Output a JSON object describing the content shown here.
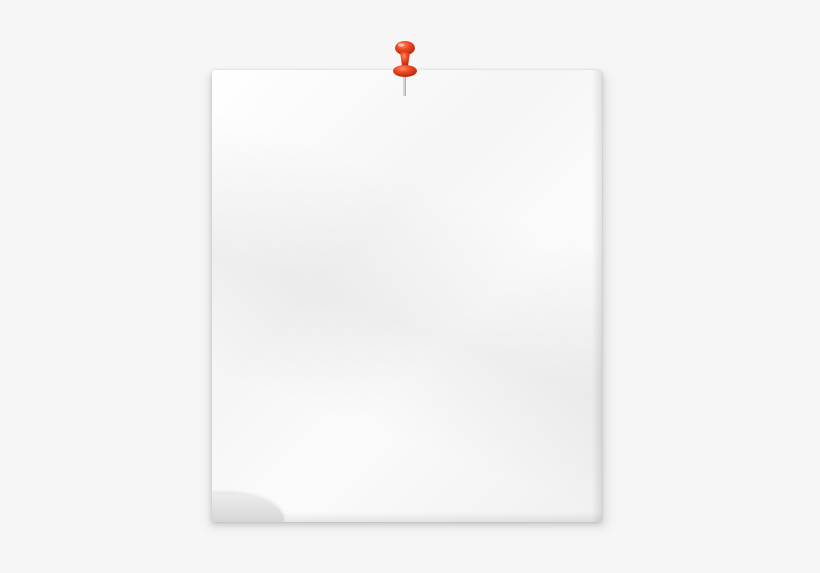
{
  "scene": {
    "background_color": "#f6f6f6",
    "paper_color": "#ffffff",
    "pin_color": "#e8401c"
  },
  "icons": {
    "pin": "pushpin-icon"
  }
}
